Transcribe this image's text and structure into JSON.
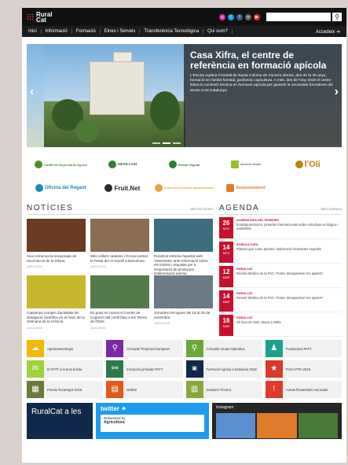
{
  "header": {
    "logo_line1": "Rural",
    "logo_line2": "Cat",
    "social_icons": [
      "instagram-icon",
      "twitter-icon",
      "facebook-icon",
      "flickr-icon",
      "youtube-icon"
    ],
    "search_placeholder": "",
    "search_icon": "search-icon"
  },
  "nav": {
    "items": [
      {
        "label": "Inici"
      },
      {
        "label": "Informació"
      },
      {
        "label": "Formació"
      },
      {
        "label": "Eines i Serveis"
      },
      {
        "label": "Transferència Tecnològica"
      },
      {
        "label": "Qui som?"
      }
    ],
    "access_label": "Accedeix"
  },
  "hero": {
    "title": "Casa Xifra, el centre de referència en formació apícola",
    "text": "L'Escola Agrària Forestal de Santa Coloma de Farners ofereix, des de fa 30 anys, formació en l'àmbit forestal, jardineria i apicultura. A més, des de l'any 2018 el centre lidera la comissió tècnica en formació apícola per garantir la necessitat formatives del sector a tot Catalunya."
  },
  "partners": [
    {
      "name": "CAMPUS Empresarial Agroal",
      "color": "#4a8f2a"
    },
    {
      "name": "xarxa-i.cat",
      "color": "#3a7a3a"
    },
    {
      "name": "Herbal Vegetal",
      "color": "#2e7d32"
    },
    {
      "name": "Xarxa de Gestió",
      "color": "#9bbf2a"
    },
    {
      "name": "l'Oli",
      "color": "#b8860b"
    },
    {
      "name": "Oficina del Regant",
      "color": "#1a8bb4"
    },
    {
      "name": "Fruit.Net",
      "color": "#2a2a2a"
    },
    {
      "name": "Suport a la innovació agroalimentària",
      "color": "#e8a33c"
    },
    {
      "name": "Assessorament",
      "color": "#e07b2a"
    }
  ],
  "news": {
    "title": "NOTÍCIES",
    "more": "MÉS NOTÍCIES",
    "items": [
      {
        "title": "Avui comença la temporada de recol·lecció de la tòfona",
        "date": "14/11/2018",
        "color": "#6b3b22"
      },
      {
        "title": "Més cellers catalans i l'Incavi porten la Festa del Vi Novell a Barcelona",
        "date": "14/11/2018",
        "color": "#8a6e54"
      },
      {
        "title": "RuralCat estrena l'apartat web 'Veterinaris' amb informació sobre els tràmits i requisits per a l'exportació de productes d'alimentació animal",
        "date": "14/11/2018",
        "color": "#3c6e7e"
      },
      {
        "title": "Catalunya compte d'activitats de divulgació científica en el marc de la Setmana de la Ciència",
        "date": "14/11/2018",
        "color": "#c8b72e"
      },
      {
        "title": "Es posa en marxa el Centre de Cognició del conill blau a les Terres de l'Ebre",
        "date": "14/11/2018",
        "color": "#557a4a"
      },
      {
        "title": "Jornades tècniques del 15 al 25 de novembre",
        "date": "14/11/2018",
        "color": "#6b7a84"
      }
    ]
  },
  "agenda": {
    "title": "AGENDA",
    "more": "MÉS AGENDA",
    "items": [
      {
        "day": "26",
        "month": "NOV",
        "category": "ALIMENTÀRIA DEL PENEDÈS",
        "text": "EcoEspumósVins: jornades internacionals sobre viticultura ecològica i sostenible"
      },
      {
        "day": "14",
        "month": "NOV",
        "category": "AGRICULTURA",
        "text": "Plantes que curen plantes: elaboració d'extractes vegetals"
      },
      {
        "day": "12",
        "month": "MAR",
        "category": "RURALCAT",
        "text": "Revisió Mèdica de la PAC: Poden desaparèixer les ajudes?"
      },
      {
        "day": "14",
        "month": "MAR",
        "category": "RURALCAT",
        "text": "Revisió Mèdica de la PAC: Poden desaparèixer les ajudes?"
      },
      {
        "day": "16",
        "month": "MAR",
        "category": "RURALCAT",
        "text": "Oli Nou de Sant Josep a Alella"
      }
    ]
  },
  "links": [
    {
      "label": "Agrometeorologia",
      "color": "#f2b80a",
      "icon": "weather-icon"
    },
    {
      "label": "Cercador Projectes Europeus",
      "color": "#7a2aa6",
      "icon": "search-icon"
    },
    {
      "label": "Cercador Grups Operatius",
      "color": "#6aa83a",
      "icon": "search-icon"
    },
    {
      "label": "Fundacions PATT",
      "color": "#1aa38a",
      "icon": "user-icon"
    },
    {
      "label": "El PATT a la teva bústia",
      "color": "#9ed23a",
      "icon": "mail-icon"
    },
    {
      "label": "Inscripció jornades PATT",
      "color": "#2a7a4a",
      "icon": "share-icon"
    },
    {
      "label": "Formació Agrària a Distància 2018",
      "color": "#10284a",
      "icon": "fad-icon"
    },
    {
      "label": "Premi PITA 2018",
      "color": "#d93a2a",
      "icon": "award-icon"
    },
    {
      "label": "Premis RuralApps 2018",
      "color": "#6b7a3a",
      "icon": "app-icon"
    },
    {
      "label": "Butlletí",
      "color": "#e05a1a",
      "icon": "bulletin-icon"
    },
    {
      "label": "Dossiers Tècnics",
      "color": "#8aa83a",
      "icon": "dossier-icon"
    },
    {
      "label": "Avisos fitosanitaris mensuals",
      "color": "#e03a2a",
      "icon": "alert-icon"
    }
  ],
  "footer": {
    "ruralcat": "RuralCat a les",
    "twitter_title": "twitter",
    "tweet_user": "Agricultura",
    "tweet_meta": "Retweeted by",
    "instagram_title": "Instagram"
  }
}
